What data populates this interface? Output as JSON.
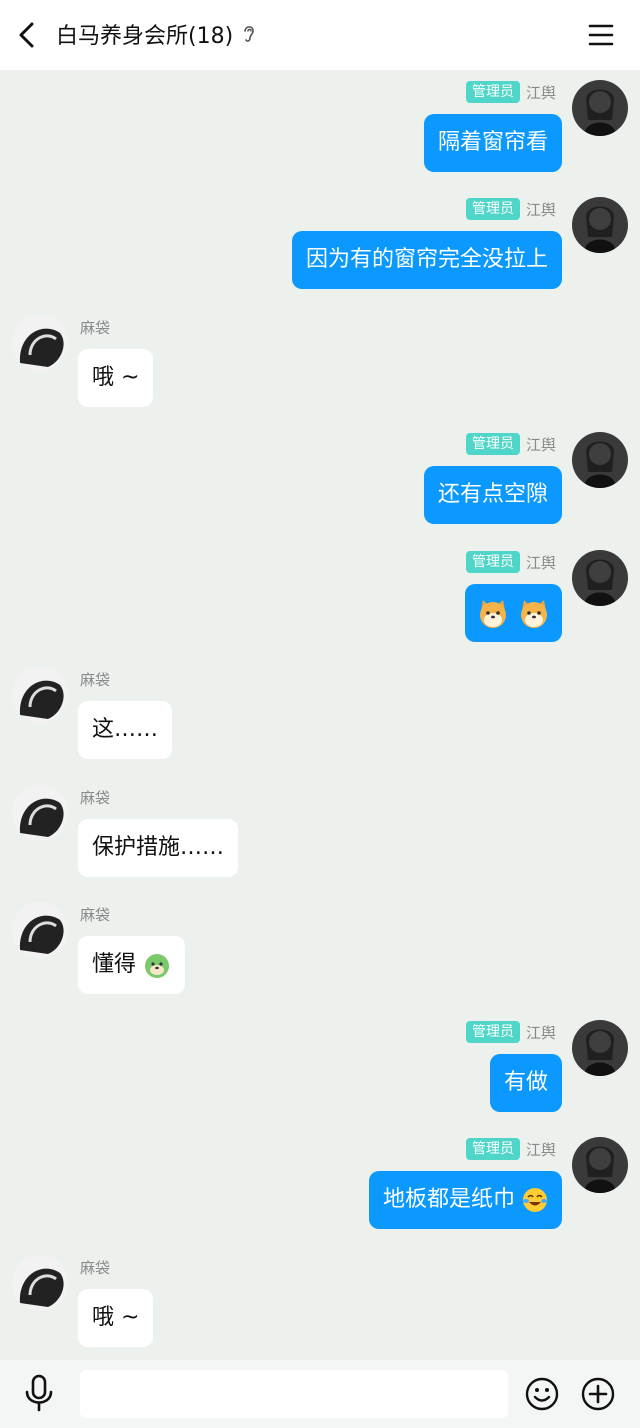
{
  "header": {
    "title": "白马养身会所(18)",
    "icons": {
      "back": "chevron-left-icon",
      "ear": "ear-icon",
      "menu": "hamburger-menu-icon"
    }
  },
  "colors": {
    "background": "#edf1ee",
    "outgoing_bubble": "#0b99ff",
    "incoming_bubble": "#ffffff",
    "admin_badge": "#4fd6c8"
  },
  "messages": [
    {
      "direction": "out",
      "badge": "管理员",
      "sender": "江舆",
      "text": "隔着窗帘看"
    },
    {
      "direction": "out",
      "badge": "管理员",
      "sender": "江舆",
      "text": "因为有的窗帘完全没拉上"
    },
    {
      "direction": "in",
      "sender": "麻袋",
      "text": "哦 ~"
    },
    {
      "direction": "out",
      "badge": "管理员",
      "sender": "江舆",
      "text": "还有点空隙"
    },
    {
      "direction": "out",
      "badge": "管理员",
      "sender": "江舆",
      "text": "",
      "emoji": "shiba-dog-emoji x2"
    },
    {
      "direction": "in",
      "sender": "麻袋",
      "text": "这……"
    },
    {
      "direction": "in",
      "sender": "麻袋",
      "text": "保护措施……"
    },
    {
      "direction": "in",
      "sender": "麻袋",
      "text": "懂得",
      "emoji": "green-dog-emoji"
    },
    {
      "direction": "out",
      "badge": "管理员",
      "sender": "江舆",
      "text": "有做"
    },
    {
      "direction": "out",
      "badge": "管理员",
      "sender": "江舆",
      "text": "地板都是纸巾",
      "emoji": "laughing-tears-emoji"
    },
    {
      "direction": "in",
      "sender": "麻袋",
      "text": "哦 ~"
    }
  ],
  "input_bar": {
    "placeholder": "",
    "icons": {
      "mic": "microphone-icon",
      "emoji": "smiley-icon",
      "plus": "plus-icon"
    }
  }
}
